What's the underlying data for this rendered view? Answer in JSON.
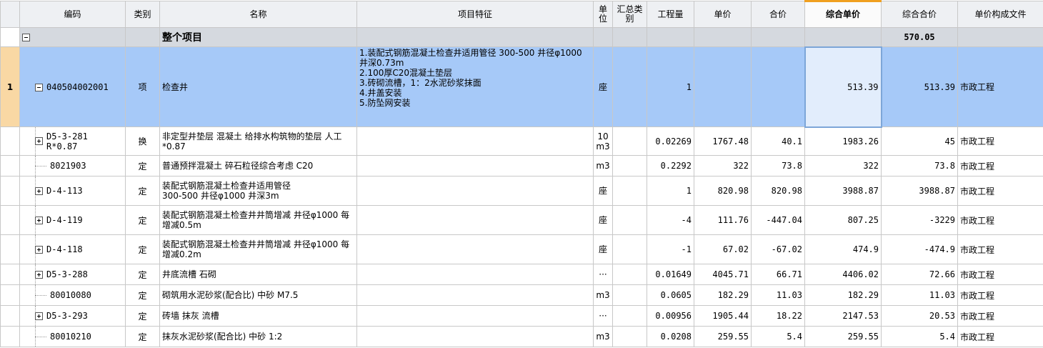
{
  "columns": [
    "编码",
    "类别",
    "名称",
    "项目特征",
    "单\n位",
    "汇总类\n别",
    "工程量",
    "单价",
    "合价",
    "综合单价",
    "综合合价",
    "单价构成文件"
  ],
  "summary": {
    "name": "整个项目",
    "total": "570.05"
  },
  "main_row": {
    "rownum": "1",
    "code": "040504002001",
    "type": "项",
    "name": "检查井",
    "features": "1.装配式钢筋混凝土检查井适用管径 300-500 井径φ1000 井深0.73m\n2.100厚C20混凝土垫层\n3.砖砌流槽，1：2水泥砂浆抹面\n4.井盖安装\n5.防坠网安装",
    "unit": "座",
    "qty": "1",
    "price": "",
    "amount": "",
    "comp_price": "513.39",
    "comp_amount": "513.39",
    "file": "市政工程"
  },
  "rows": [
    {
      "expand": true,
      "code": "D5-3-281\nR*0.87",
      "type": "换",
      "name": "非定型井垫层 混凝土  给排水构筑物的垫层 人工*0.87",
      "unit": "10\nm3",
      "qty": "0.02269",
      "price": "1767.48",
      "amount": "40.1",
      "comp_price": "1983.26",
      "comp_amount": "45",
      "file": "市政工程"
    },
    {
      "expand": false,
      "code": "8021903",
      "type": "定",
      "name": "普通预拌混凝土 碎石粒径综合考虑 C20",
      "unit": "m3",
      "qty": "0.2292",
      "price": "322",
      "amount": "73.8",
      "comp_price": "322",
      "comp_amount": "73.8",
      "file": "市政工程"
    },
    {
      "expand": true,
      "code": "D-4-113",
      "type": "定",
      "name": "装配式钢筋混凝土检查井适用管径\n300-500 井径φ1000 井深3m",
      "unit": "座",
      "qty": "1",
      "price": "820.98",
      "amount": "820.98",
      "comp_price": "3988.87",
      "comp_amount": "3988.87",
      "file": "市政工程"
    },
    {
      "expand": true,
      "code": "D-4-119",
      "type": "定",
      "name": "装配式钢筋混凝土检查井井筒增减 井径φ1000 每增减0.5m",
      "unit": "座",
      "qty": "-4",
      "price": "111.76",
      "amount": "-447.04",
      "comp_price": "807.25",
      "comp_amount": "-3229",
      "file": "市政工程"
    },
    {
      "expand": true,
      "code": "D-4-118",
      "type": "定",
      "name": "装配式钢筋混凝土检查井井筒增减 井径φ1000 每增减0.2m",
      "unit": "座",
      "qty": "-1",
      "price": "67.02",
      "amount": "-67.02",
      "comp_price": "474.9",
      "comp_amount": "-474.9",
      "file": "市政工程"
    },
    {
      "expand": true,
      "code": "D5-3-288",
      "type": "定",
      "name": "井底流槽 石砌",
      "unit": "···",
      "qty": "0.01649",
      "price": "4045.71",
      "amount": "66.71",
      "comp_price": "4406.02",
      "comp_amount": "72.66",
      "file": "市政工程"
    },
    {
      "expand": false,
      "code": "80010080",
      "type": "定",
      "name": "砌筑用水泥砂浆(配合比) 中砂 M7.5",
      "unit": "m3",
      "qty": "0.0605",
      "price": "182.29",
      "amount": "11.03",
      "comp_price": "182.29",
      "comp_amount": "11.03",
      "file": "市政工程"
    },
    {
      "expand": true,
      "code": "D5-3-293",
      "type": "定",
      "name": "砖墙 抹灰 流槽",
      "unit": "···",
      "qty": "0.00956",
      "price": "1905.44",
      "amount": "18.22",
      "comp_price": "2147.53",
      "comp_amount": "20.53",
      "file": "市政工程"
    },
    {
      "expand": false,
      "code": "80010210",
      "type": "定",
      "name": "抹灰水泥砂浆(配合比) 中砂 1:2",
      "unit": "m3",
      "qty": "0.0208",
      "price": "259.55",
      "amount": "5.4",
      "comp_price": "259.55",
      "comp_amount": "5.4",
      "file": "市政工程"
    }
  ],
  "colors": {
    "header": "#eef0f3",
    "summary": "#d5d9df",
    "selected": "#a6c9f8",
    "active_col": "#f0a020"
  }
}
